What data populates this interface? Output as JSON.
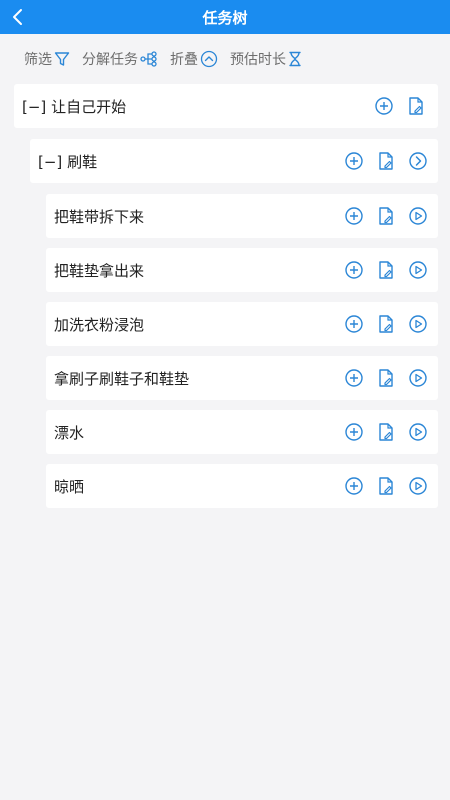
{
  "header": {
    "title": "任务树"
  },
  "toolbar": {
    "filter_label": "筛选",
    "decompose_label": "分解任务",
    "collapse_label": "折叠",
    "estimate_label": "预估时长"
  },
  "tree": {
    "root": {
      "toggle": "[−]",
      "label": "让自己开始"
    },
    "child": {
      "toggle": "[−]",
      "label": "刷鞋"
    },
    "leaves": [
      {
        "label": "把鞋带拆下来"
      },
      {
        "label": "把鞋垫拿出来"
      },
      {
        "label": "加洗衣粉浸泡"
      },
      {
        "label": "拿刷子刷鞋子和鞋垫"
      },
      {
        "label": "漂水"
      },
      {
        "label": "晾晒"
      }
    ]
  },
  "colors": {
    "accent": "#1a8cf0",
    "icon": "#2b86d6",
    "background": "#f4f4f6"
  },
  "icons": [
    "back-chevron-icon",
    "filter-funnel-icon",
    "tree-branch-icon",
    "collapse-up-icon",
    "hourglass-icon",
    "add-circle-icon",
    "edit-document-icon",
    "chevron-right-circle-icon",
    "play-circle-icon"
  ]
}
